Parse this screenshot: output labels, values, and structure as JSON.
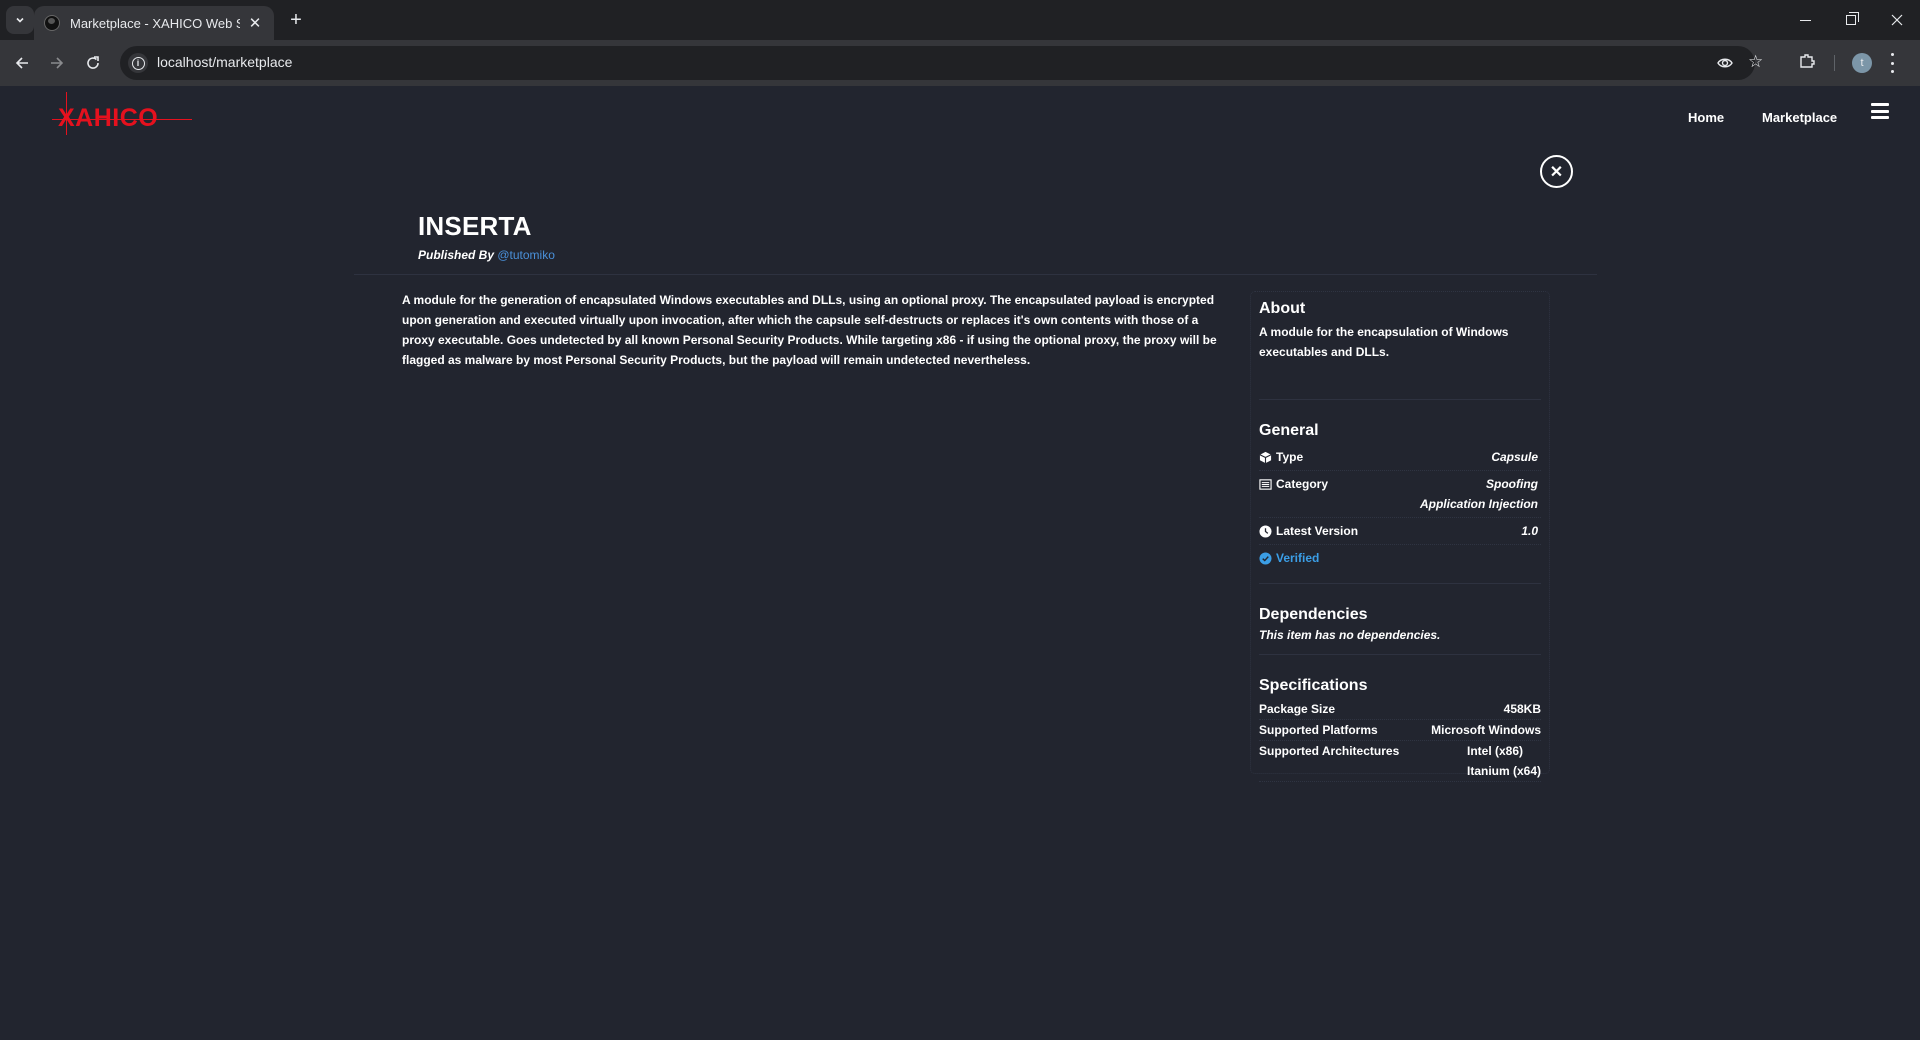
{
  "browser": {
    "tab_title": "Marketplace - XAHICO Web Sol",
    "url": "localhost/marketplace",
    "profile_initial": "t",
    "new_tab_label": "+",
    "tab_close_glyph": "✕"
  },
  "site": {
    "logo_text": "XAHICO",
    "nav": [
      {
        "label": "Home"
      },
      {
        "label": "Marketplace"
      }
    ],
    "close_glyph": "✕"
  },
  "item": {
    "title": "INSERTA",
    "published_by_label": "Published By",
    "publisher": "@tutomiko",
    "description": "A module for the generation of encapsulated Windows executables and DLLs, using an optional proxy. The encapsulated payload is encrypted upon generation and executed virtually upon invocation, after which the capsule self-destructs or replaces it's own contents with those of a proxy executable. Goes undetected by all known Personal Security Products. While targeting x86 - if using the optional proxy, the proxy will be flagged as malware by most Personal Security Products, but the payload will remain undetected nevertheless."
  },
  "panel": {
    "about": {
      "heading": "About",
      "text": "A module for the encapsulation of Windows executables and DLLs."
    },
    "general": {
      "heading": "General",
      "type_label": "Type",
      "type_value": "Capsule",
      "category_label": "Category",
      "category_values": [
        "Spoofing",
        "Application Injection"
      ],
      "version_label": "Latest Version",
      "version_value": "1.0",
      "verified_label": "Verified"
    },
    "dependencies": {
      "heading": "Dependencies",
      "text": "This item has no dependencies."
    },
    "specifications": {
      "heading": "Specifications",
      "rows": [
        {
          "label": "Package Size",
          "values": [
            "458KB"
          ]
        },
        {
          "label": "Supported Platforms",
          "values": [
            "Microsoft Windows"
          ]
        },
        {
          "label": "Supported Architectures",
          "values": [
            "Intel (x86)",
            "Itanium (x64)"
          ]
        }
      ]
    }
  },
  "colors": {
    "page_bg": "#22252f",
    "brand_red": "#e5111e",
    "link_blue": "#4a90d9",
    "verified_blue": "#3b9ee6"
  }
}
